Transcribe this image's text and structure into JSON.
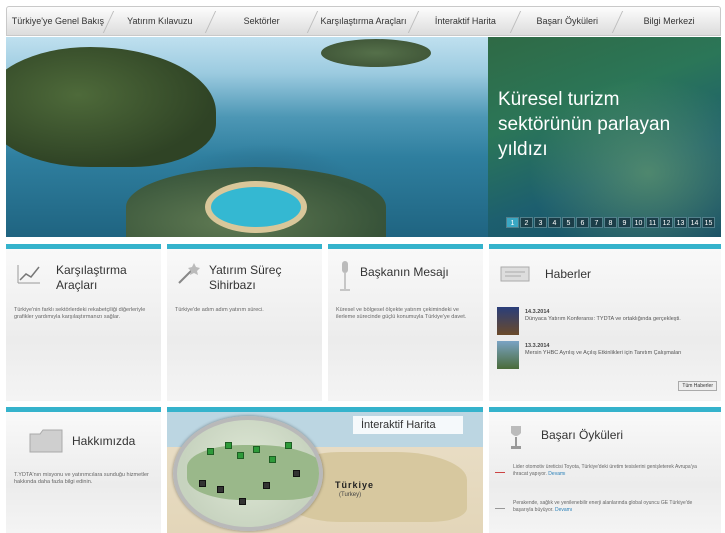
{
  "nav": {
    "items": [
      "Türkiye'ye Genel Bakış",
      "Yatırım Kılavuzu",
      "Sektörler",
      "Karşılaştırma Araçları",
      "İnteraktif Harita",
      "Başarı Öyküleri",
      "Bilgi Merkezi"
    ]
  },
  "hero": {
    "title": "Küresel turizm sektörünün parlayan yıldızı",
    "pages": [
      "1",
      "2",
      "3",
      "4",
      "5",
      "6",
      "7",
      "8",
      "9",
      "10",
      "11",
      "12",
      "13",
      "14",
      "15"
    ],
    "active_page": "1"
  },
  "cards": {
    "comparison": {
      "title_line1": "Karşılaştırma",
      "title_line2": "Araçları",
      "text": "Türkiye'nin farklı sektörlerdeki rekabetçiliği diğerleriyle grafikler yardımıyla karşılaştırmanızı sağlar."
    },
    "wizard": {
      "title_line1": "Yatırım Süreç",
      "title_line2": "Sihirbazı",
      "text": "Türkiye'de adım adım yatırım süreci."
    },
    "president": {
      "title": "Başkanın Mesajı",
      "text": "Küresel ve bölgesel ölçekte yatırım çekimindeki ve ilerleme sürecinde güçlü konumuyla Türkiye'ye davet."
    },
    "news": {
      "title": "Haberler",
      "items": [
        {
          "date": "14.3.2014",
          "text": "Dünyaca Yatırım Konferansı: TYDTA ve ortaklığında gerçekleşti."
        },
        {
          "date": "13.3.2014",
          "text": "Mersin YHBC Ayrılış ve Açılış Etkinlikleri için Tanıtım Çalışmaları"
        }
      ],
      "all_label": "Tüm Haberler"
    },
    "about": {
      "title": "Hakkımızda",
      "text": "T.YDTA'nın misyonu ve yatırımcılara sunduğu hizmetler hakkında daha fazla bilgi edinin."
    },
    "map": {
      "title": "İnteraktif Harita",
      "country": "Türkiye",
      "country_sub": "(Turkey)"
    },
    "stories": {
      "title": "Başarı Öyküleri",
      "items": [
        {
          "text": "Lider otomotiv üreticisi Toyota, Türkiye'deki üretim tesislerini genişleterek Avrupa'ya ihracat yapıyor.",
          "link": "Devamı"
        },
        {
          "text": "Perakende, sağlık ve yenilenebilir enerji alanlarında global oyuncu GE Türkiye'de başarıyla büyüyor.",
          "link": "Devamı"
        }
      ]
    }
  },
  "colors": {
    "accent": "#35b3cc",
    "hero_panel": "#1f6a5e"
  }
}
